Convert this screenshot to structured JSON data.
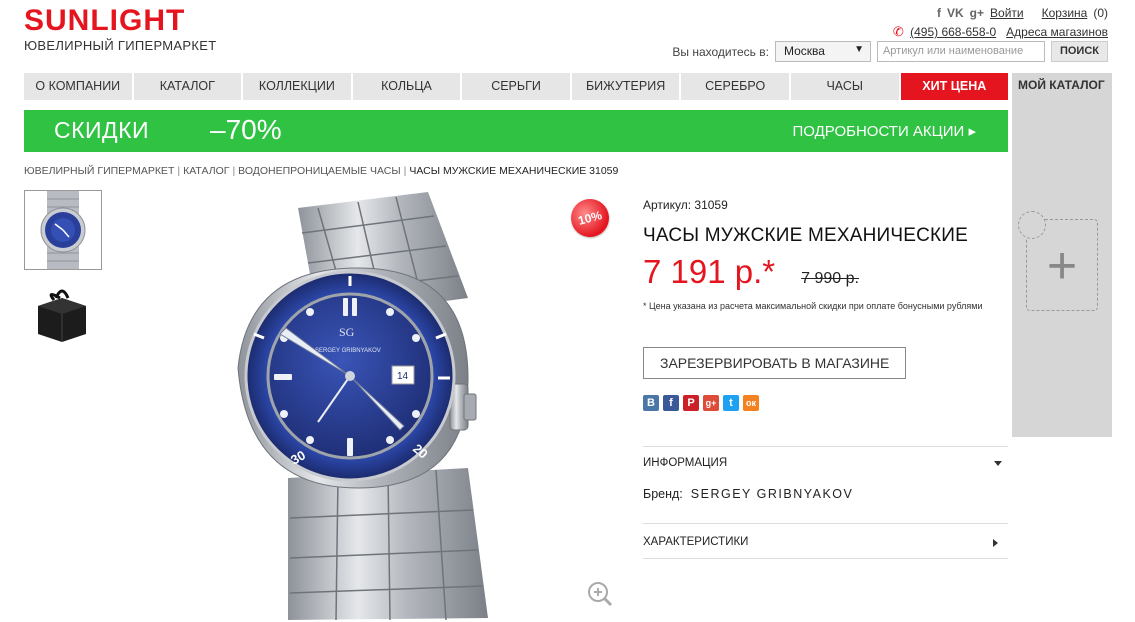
{
  "header": {
    "logo": "SUNLIGHT",
    "tagline": "ЮВЕЛИРНЫЙ ГИПЕРМАРКЕТ",
    "social_f": "f",
    "social_vk": "VK",
    "social_g": "g+",
    "login": "Войти",
    "cart_label": "Корзина",
    "cart_count": "(0)",
    "phone": "(495) 668-658-0",
    "stores_link": "Адреса магазинов",
    "location_label": "Вы находитесь в:",
    "city": "Москва",
    "search_placeholder": "Артикул или наименование",
    "search_button": "ПОИСК"
  },
  "nav": [
    {
      "label": "О КОМПАНИИ"
    },
    {
      "label": "КАТАЛОГ"
    },
    {
      "label": "КОЛЛЕКЦИИ"
    },
    {
      "label": "КОЛЬЦА"
    },
    {
      "label": "СЕРЬГИ"
    },
    {
      "label": "БИЖУТЕРИЯ"
    },
    {
      "label": "СЕРЕБРО"
    },
    {
      "label": "ЧАСЫ"
    },
    {
      "label": "ХИТ ЦЕНА"
    }
  ],
  "my_catalog": {
    "title": "МОЙ КАТАЛОГ"
  },
  "banner": {
    "left": "СКИДКИ",
    "percent": "–70%",
    "right": "ПОДРОБНОСТИ АКЦИИ ▸"
  },
  "breadcrumb": [
    "ЮВЕЛИРНЫЙ ГИПЕРМАРКЕТ",
    "КАТАЛОГ",
    "ВОДОНЕПРОНИЦАЕМЫЕ ЧАСЫ",
    "ЧАСЫ МУЖСКИЕ МЕХАНИЧЕСКИЕ 31059"
  ],
  "breadcrumb_sep": "|",
  "product": {
    "article": "Артикул: 31059",
    "name": "ЧАСЫ МУЖСКИЕ МЕХАНИЧЕСКИЕ",
    "price": "7 191 р.*",
    "old_price": "7 990 р.",
    "discount_badge": "10%",
    "price_note": "* Цена указана из расчета максимальной скидки при оплате бонусными рублями",
    "reserve_button": "ЗАРЕЗЕРВИРОВАТЬ В МАГАЗИНЕ",
    "watch_logo": "SG",
    "watch_brand_text": "SERGEY GRIBNYAKOV",
    "date_window": "14"
  },
  "share": [
    {
      "name": "vkontakte",
      "glyph": "B",
      "color": "#4a76a8"
    },
    {
      "name": "facebook",
      "glyph": "f",
      "color": "#3b5998"
    },
    {
      "name": "pinterest",
      "glyph": "P",
      "color": "#cb2027"
    },
    {
      "name": "google-plus",
      "glyph": "g+",
      "color": "#dd4b39"
    },
    {
      "name": "twitter",
      "glyph": "t",
      "color": "#1da1f2"
    },
    {
      "name": "odnoklassniki",
      "glyph": "ок",
      "color": "#f58220"
    }
  ],
  "sections": {
    "info_title": "ИНФОРМАЦИЯ",
    "brand_label": "Бренд:",
    "brand_value": "SERGEY GRIBNYAKOV",
    "characteristics_title": "ХАРАКТЕРИСТИКИ"
  },
  "colors": {
    "brand_red": "#e4151f",
    "promo_green": "#2fc243",
    "dial_blue": "#2a3f9a"
  }
}
